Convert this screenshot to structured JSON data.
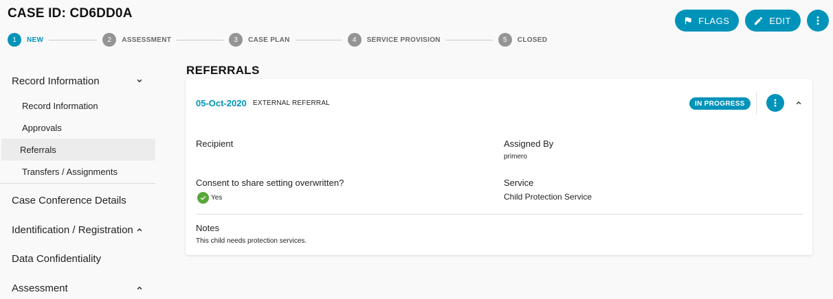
{
  "header": {
    "case_title": "CASE ID: CD6DD0A"
  },
  "stepper": {
    "steps": [
      {
        "number": "1",
        "label": "NEW",
        "active": true
      },
      {
        "number": "2",
        "label": "ASSESSMENT",
        "active": false
      },
      {
        "number": "3",
        "label": "CASE PLAN",
        "active": false
      },
      {
        "number": "4",
        "label": "SERVICE PROVISION",
        "active": false
      },
      {
        "number": "5",
        "label": "CLOSED",
        "active": false
      }
    ]
  },
  "actions": {
    "flags_label": "FLAGS",
    "edit_label": "EDIT",
    "flags_icon": "flag-icon",
    "edit_icon": "pencil-icon",
    "more_icon": "more-vertical-icon"
  },
  "sidebar": {
    "record_information": {
      "label": "Record Information",
      "items": [
        {
          "label": "Record Information"
        },
        {
          "label": "Approvals"
        },
        {
          "label": "Referrals"
        },
        {
          "label": "Transfers / Assignments"
        }
      ]
    },
    "case_conference": "Case Conference Details",
    "identification": "Identification / Registration",
    "data_confidentiality": "Data Confidentiality",
    "assessment": "Assessment"
  },
  "main": {
    "section_title": "REFERRALS",
    "referral": {
      "date": "05-Oct-2020",
      "type": "EXTERNAL REFERRAL",
      "status": "IN PROGRESS",
      "recipient_label": "Recipient",
      "recipient_value": "",
      "assigned_by_label": "Assigned By",
      "assigned_by_value": "primero",
      "consent_label": "Consent to share setting overwritten?",
      "consent_value": "Yes",
      "service_label": "Service",
      "service_value": "Child Protection Service",
      "notes_label": "Notes",
      "notes_value": "This child needs protection services."
    }
  },
  "colors": {
    "accent": "#0093ba",
    "check_green": "#58a63b",
    "inactive_step": "#949494"
  }
}
